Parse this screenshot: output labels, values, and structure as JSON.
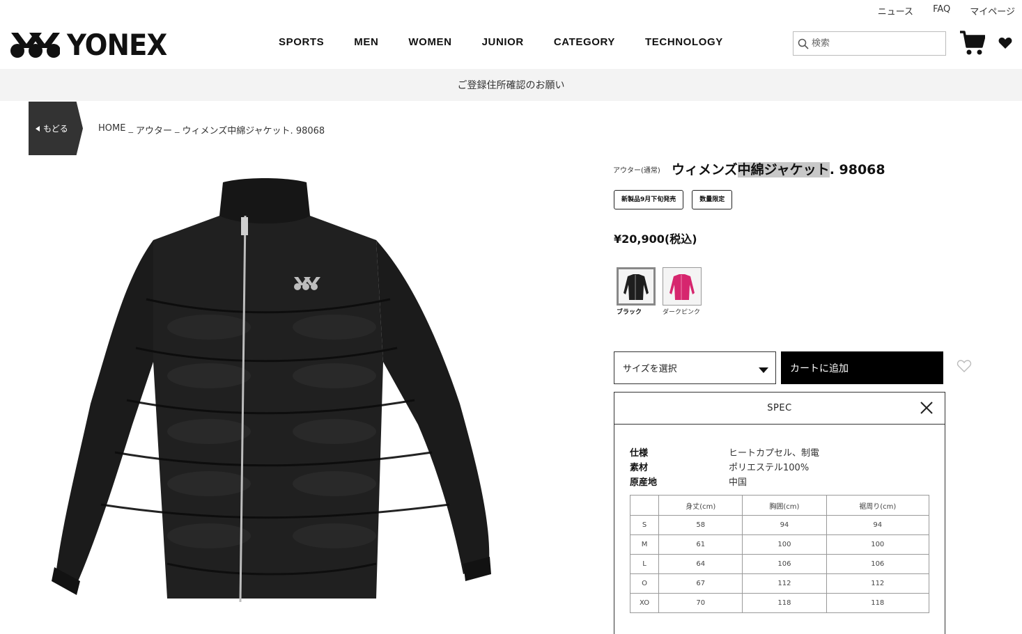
{
  "utility_links": [
    "ニュース",
    "FAQ",
    "マイページ"
  ],
  "brand": {
    "name": "YONEX"
  },
  "nav": [
    "SPORTS",
    "MEN",
    "WOMEN",
    "JUNIOR",
    "CATEGORY",
    "TECHNOLOGY"
  ],
  "search": {
    "placeholder": "検索"
  },
  "notice": "ご登録住所確認のお願い",
  "back_label": "もどる",
  "breadcrumb": {
    "home": "HOME",
    "sep": "_",
    "category": "アウター",
    "current": "ウィメンズ中綿ジャケット. 98068"
  },
  "product": {
    "category": "アウター(通常)",
    "title_pre": "ウィメンズ",
    "title_hl": "中綿ジャケット",
    "title_post": ". 98068",
    "badges": [
      "新製品9月下旬発売",
      "数量限定"
    ],
    "price": "¥20,900(税込)",
    "colors": [
      {
        "name": "ブラック",
        "hex": "#1e1e1e",
        "selected": true
      },
      {
        "name": "ダークピンク",
        "hex": "#d6266e",
        "selected": false
      }
    ],
    "size_select": "サイズを選択",
    "add_to_cart": "カートに追加"
  },
  "spec": {
    "title": "SPEC",
    "rows": [
      {
        "k": "仕様",
        "v": "ヒートカプセル、制電"
      },
      {
        "k": "素材",
        "v": "ポリエステル100%"
      },
      {
        "k": "原産地",
        "v": "中国"
      }
    ],
    "size_table": {
      "headers": [
        "",
        "身丈(cm)",
        "胸囲(cm)",
        "裾周り(cm)"
      ],
      "rows": [
        [
          "S",
          "58",
          "94",
          "94"
        ],
        [
          "M",
          "61",
          "100",
          "100"
        ],
        [
          "L",
          "64",
          "106",
          "106"
        ],
        [
          "O",
          "67",
          "112",
          "112"
        ],
        [
          "XO",
          "70",
          "118",
          "118"
        ]
      ]
    }
  }
}
